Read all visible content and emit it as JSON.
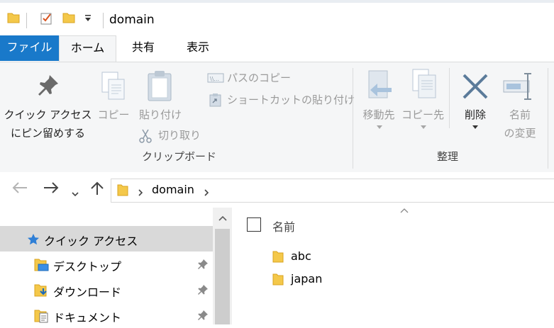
{
  "window": {
    "title": "domain"
  },
  "ribbon_tabs": {
    "file": "ファイル",
    "home": "ホーム",
    "share": "共有",
    "view": "表示"
  },
  "clipboard": {
    "pin_quick_access_line1": "クイック アクセス",
    "pin_quick_access_line2": "にピン留めする",
    "copy": "コピー",
    "paste": "貼り付け",
    "copy_path": "パスのコピー",
    "paste_shortcut": "ショートカットの貼り付け",
    "cut": "切り取り",
    "group_label": "クリップボード"
  },
  "organize": {
    "move_to": "移動先",
    "copy_to": "コピー先",
    "delete": "削除",
    "rename_line1": "名前",
    "rename_line2": "の変更",
    "group_label": "整理"
  },
  "address": {
    "path_segment": "domain"
  },
  "nav_pane": {
    "items": [
      {
        "label": "クイック アクセス",
        "icon": "star-icon"
      },
      {
        "label": "デスクトップ",
        "icon": "desktop-folder-icon"
      },
      {
        "label": "ダウンロード",
        "icon": "downloads-folder-icon"
      },
      {
        "label": "ドキュメント",
        "icon": "documents-folder-icon"
      }
    ]
  },
  "file_list": {
    "column_name": "名前",
    "items": [
      {
        "name": "abc"
      },
      {
        "name": "japan"
      }
    ]
  },
  "colors": {
    "file_tab": "#1979ca",
    "folder": "#f4c84a",
    "ribbon_bg": "#f5f6f7",
    "selected": "#d9d9d9"
  }
}
